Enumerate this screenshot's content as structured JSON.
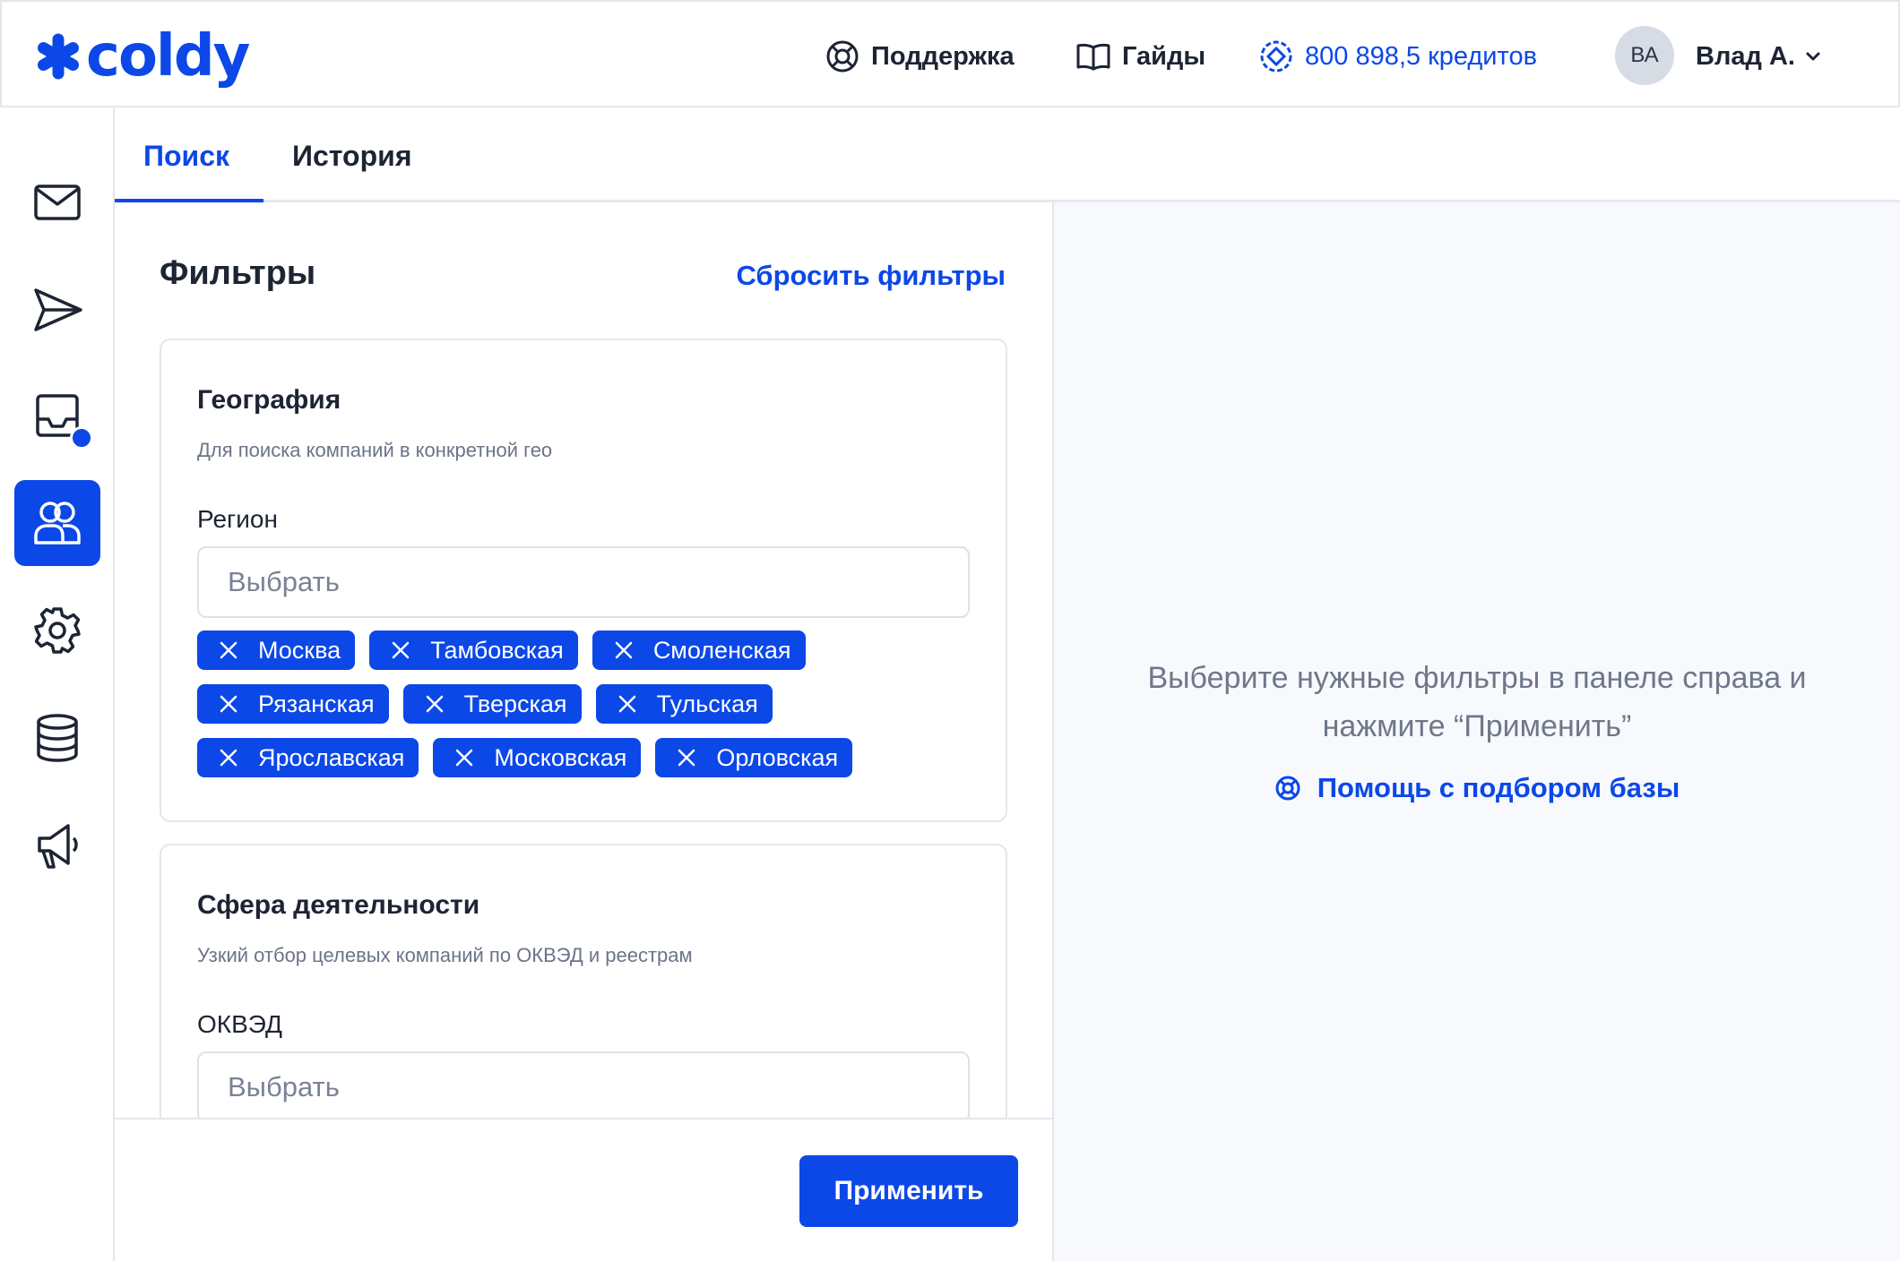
{
  "header": {
    "logo_text": "coldy",
    "nav": [
      {
        "label": "Поддержка",
        "icon": "lifebuoy-icon"
      },
      {
        "label": "Гайды",
        "icon": "book-icon"
      }
    ],
    "credits": {
      "label": "800 898,5 кредитов",
      "icon": "coin-icon"
    },
    "user": {
      "initials": "ВА",
      "name": "Влад А."
    }
  },
  "sidebar": {
    "items": [
      {
        "name": "mail",
        "icon": "mail-icon"
      },
      {
        "name": "send",
        "icon": "send-icon"
      },
      {
        "name": "inbox",
        "icon": "inbox-icon",
        "notification": true
      },
      {
        "name": "contacts",
        "icon": "users-icon",
        "active": true
      },
      {
        "name": "settings",
        "icon": "gear-icon"
      },
      {
        "name": "database",
        "icon": "database-icon"
      },
      {
        "name": "campaigns",
        "icon": "megaphone-icon"
      }
    ]
  },
  "tabs": [
    {
      "label": "Поиск",
      "active": true
    },
    {
      "label": "История",
      "active": false
    }
  ],
  "filters": {
    "title": "Фильтры",
    "reset_label": "Сбросить фильтры",
    "geo": {
      "title": "География",
      "description": "Для поиска компаний в конкретной гео",
      "region_label": "Регион",
      "select_placeholder": "Выбрать",
      "chips": [
        "Москва",
        "Тамбовская",
        "Смоленская",
        "Рязанская",
        "Тверская",
        "Тульская",
        "Ярославская",
        "Московская",
        "Орловская"
      ]
    },
    "industry": {
      "title": "Сфера деятельности",
      "description": "Узкий отбор целевых компаний по ОКВЭД и реестрам",
      "okved_label": "ОКВЭД",
      "select_placeholder": "Выбрать"
    },
    "apply_label": "Применить"
  },
  "empty_state": {
    "message_line1": "Выберите нужные фильтры в панеле справа и",
    "message_line2": "нажмите “Применить”",
    "help_label": "Помощь с подбором базы"
  },
  "colors": {
    "accent": "#0c47e8",
    "muted_text": "#6f7789",
    "panel_bg": "#f7f9fc"
  }
}
